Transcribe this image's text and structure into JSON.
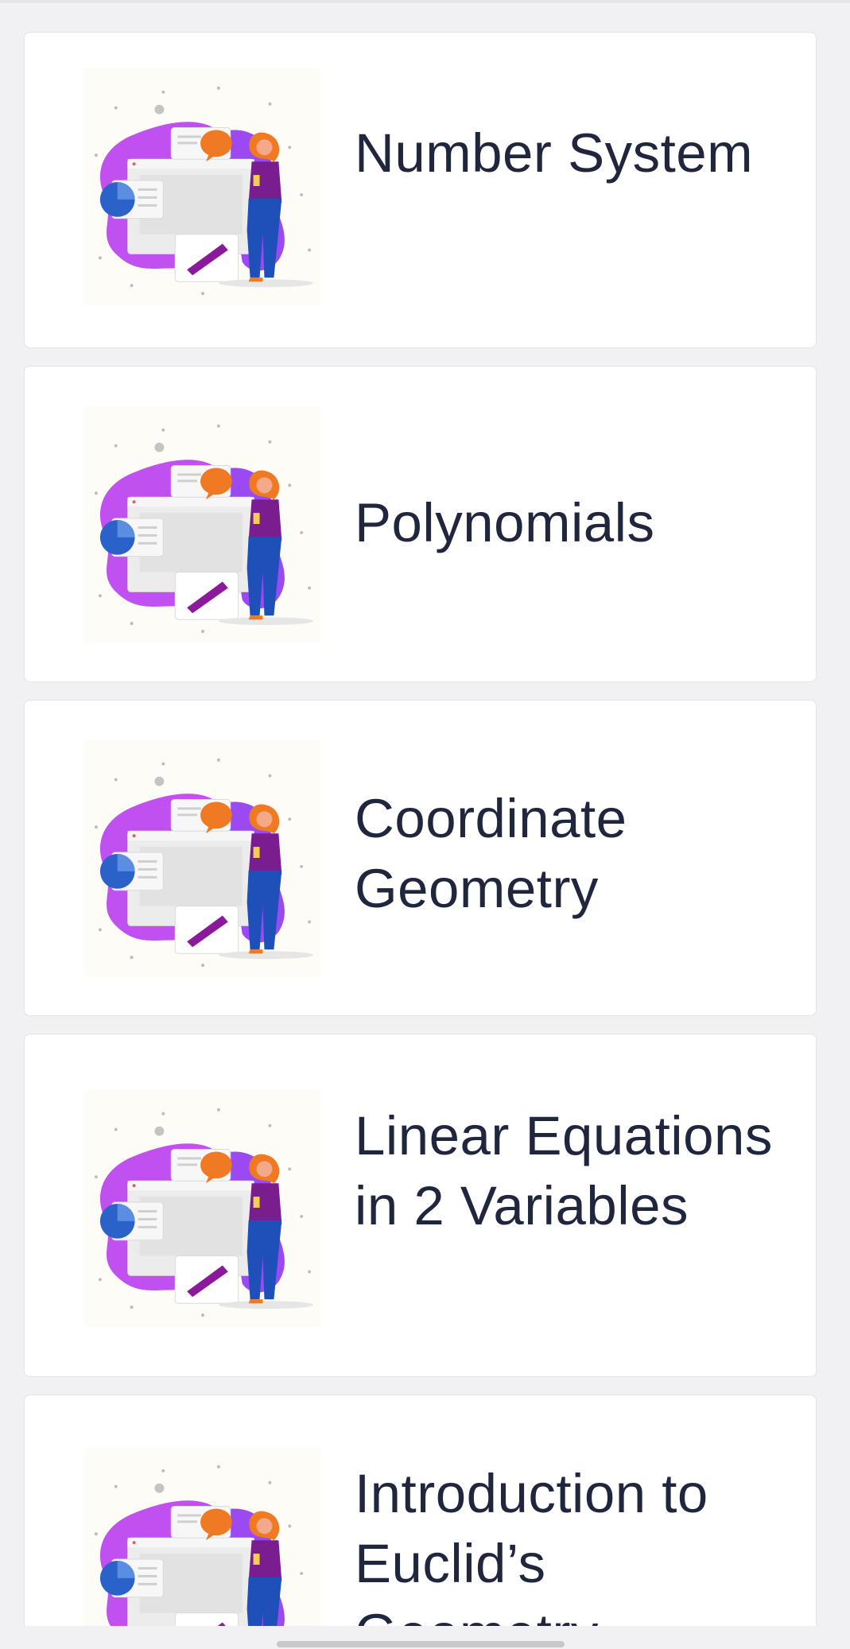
{
  "topics": [
    {
      "title": "Number System"
    },
    {
      "title": "Polynomials"
    },
    {
      "title": "Coordinate Geometry"
    },
    {
      "title": "Linear Equations in 2 Variables"
    },
    {
      "title": "Introduction to Euclid’s Geometry"
    }
  ],
  "colors": {
    "background": "#f1f1f3",
    "card": "#ffffff",
    "title_text": "#20263d",
    "blob_purple": "#c050f0",
    "accent_orange": "#f07a24",
    "accent_blue": "#2b62c9"
  },
  "icons": {
    "topic_illustration": "woman-presenting-charts-illustration"
  }
}
